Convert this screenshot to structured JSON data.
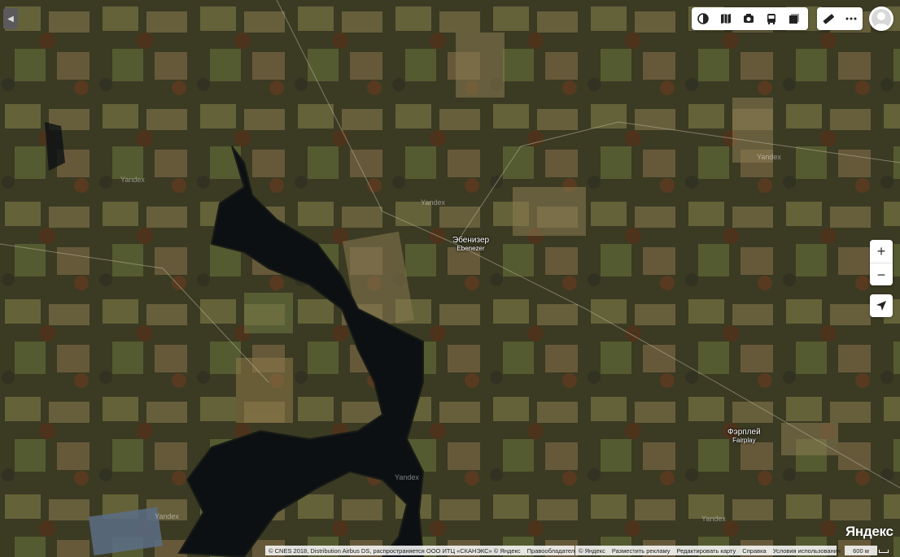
{
  "map": {
    "places": [
      {
        "name_ru": "Эбенизер",
        "name_en": "Ebenezer"
      },
      {
        "name_ru": "Фэрплей",
        "name_en": "Fairplay"
      }
    ],
    "watermark": "Yandex"
  },
  "toolbar": {
    "main_icons": [
      "layers-icon",
      "map-guide-icon",
      "camera-icon",
      "bus-icon",
      "panorama-icon"
    ],
    "extra_icons": [
      "ruler-icon",
      "more-icon"
    ]
  },
  "controls": {
    "zoom_in": "+",
    "zoom_out": "−"
  },
  "footer": {
    "attribution": "© CNES 2018, Distribution Airbus DS, распространяется ООО ИТЦ «СКАНЭКС» © Яндекс",
    "rights_holders": "Правообладатели",
    "links": [
      "© Яндекс",
      "Разместить рекламу",
      "Редактировать карту",
      "Справка",
      "Условия использования"
    ],
    "scale": "600 м",
    "logo": "Яндекс"
  },
  "colors": {
    "water": "#0b0f12",
    "field": "#6b6a3e",
    "forest": "#3a3a22",
    "autumn": "#6b3a1e",
    "control_bg": "#ffffff"
  }
}
